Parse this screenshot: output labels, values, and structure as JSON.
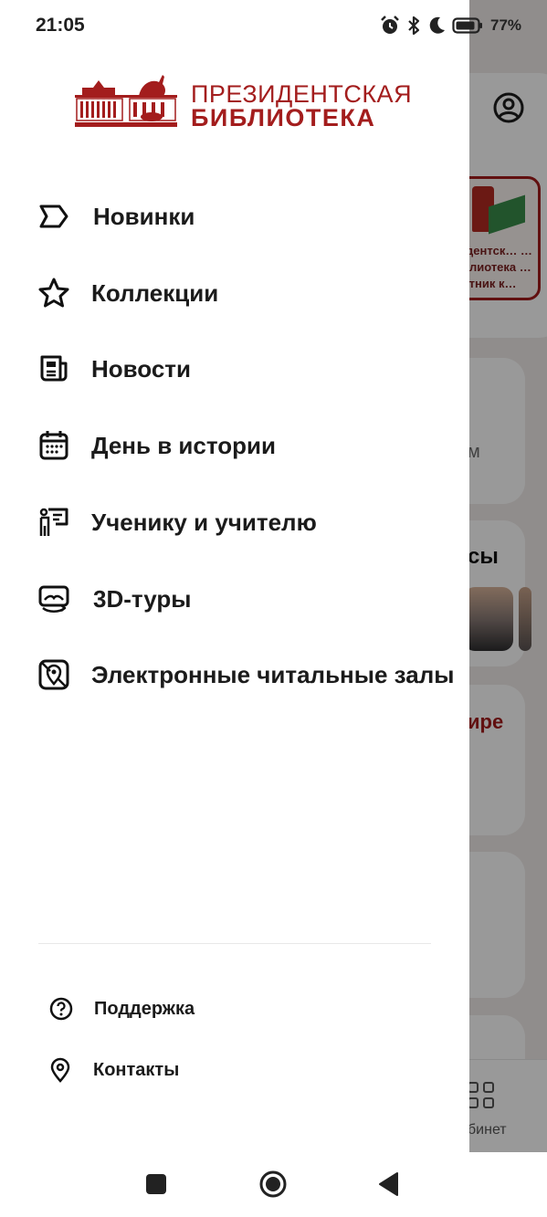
{
  "status_bar": {
    "time": "21:05",
    "battery_percent": "77%",
    "icons": [
      "alarm-icon",
      "bluetooth-icon",
      "moon-icon",
      "battery-icon"
    ]
  },
  "logo": {
    "line1": "ПРЕЗИДЕНТСКАЯ",
    "line2": "БИБЛИОТЕКА",
    "color": "#a31d1d"
  },
  "menu": {
    "items": [
      {
        "label": "Новинки",
        "icon": "tag-icon"
      },
      {
        "label": "Коллекции",
        "icon": "star-icon"
      },
      {
        "label": "Новости",
        "icon": "newspaper-icon"
      },
      {
        "label": "День в истории",
        "icon": "calendar-icon"
      },
      {
        "label": "Ученику и учителю",
        "icon": "presentation-icon"
      },
      {
        "label": "3D-туры",
        "icon": "vr-headset-icon"
      },
      {
        "label": "Электронные читальные залы",
        "icon": "map-pin-box-icon"
      }
    ]
  },
  "footer": {
    "items": [
      {
        "label": "Поддержка",
        "icon": "help-circle-icon"
      },
      {
        "label": "Контакты",
        "icon": "location-pin-icon"
      }
    ]
  },
  "background": {
    "book_caption": "…идентск… …библиотека …стник к…",
    "text_m": "м",
    "text_sy": "сы",
    "text_ire": "ире",
    "nav_label": "бинет",
    "accent_color": "#a21c1c"
  },
  "system_nav": {
    "buttons": [
      "recent-apps",
      "home",
      "back"
    ]
  }
}
